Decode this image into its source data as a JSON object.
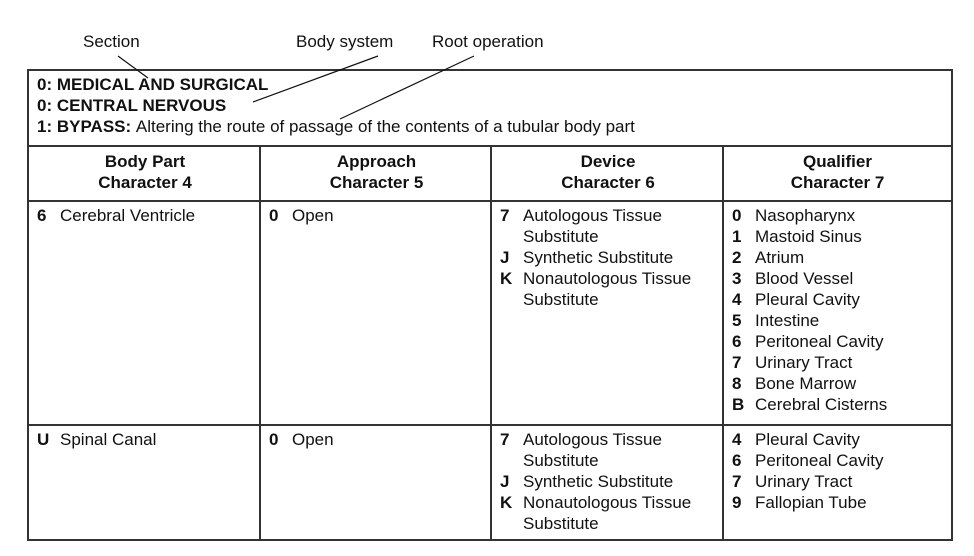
{
  "callouts": {
    "section": "Section",
    "body_system": "Body system",
    "root_operation": "Root operation"
  },
  "title_block": {
    "section": {
      "code": "0:",
      "name": "MEDICAL AND SURGICAL"
    },
    "body_system": {
      "code": "0:",
      "name": "CENTRAL NERVOUS"
    },
    "root_operation": {
      "code": "1:",
      "name": "BYPASS:",
      "definition": "Altering the route of passage of the contents of a tubular body part"
    }
  },
  "columns": [
    {
      "line1": "Body Part",
      "line2": "Character 4"
    },
    {
      "line1": "Approach",
      "line2": "Character 5"
    },
    {
      "line1": "Device",
      "line2": "Character 6"
    },
    {
      "line1": "Qualifier",
      "line2": "Character 7"
    }
  ],
  "rows": [
    {
      "body_part": [
        {
          "code": "6",
          "label": "Cerebral Ventricle"
        }
      ],
      "approach": [
        {
          "code": "0",
          "label": "Open"
        }
      ],
      "device": [
        {
          "code": "7",
          "label": "Autologous Tissue Substitute"
        },
        {
          "code": "J",
          "label": "Synthetic Substitute"
        },
        {
          "code": "K",
          "label": "Nonautologous Tissue Substitute"
        }
      ],
      "qualifier": [
        {
          "code": "0",
          "label": "Nasopharynx"
        },
        {
          "code": "1",
          "label": "Mastoid Sinus"
        },
        {
          "code": "2",
          "label": "Atrium"
        },
        {
          "code": "3",
          "label": "Blood Vessel"
        },
        {
          "code": "4",
          "label": "Pleural Cavity"
        },
        {
          "code": "5",
          "label": "Intestine"
        },
        {
          "code": "6",
          "label": "Peritoneal Cavity"
        },
        {
          "code": "7",
          "label": "Urinary Tract"
        },
        {
          "code": "8",
          "label": "Bone Marrow"
        },
        {
          "code": "B",
          "label": "Cerebral Cisterns"
        }
      ]
    },
    {
      "body_part": [
        {
          "code": "U",
          "label": "Spinal Canal"
        }
      ],
      "approach": [
        {
          "code": "0",
          "label": "Open"
        }
      ],
      "device": [
        {
          "code": "7",
          "label": "Autologous Tissue Substitute"
        },
        {
          "code": "J",
          "label": "Synthetic Substitute"
        },
        {
          "code": "K",
          "label": "Nonautologous Tissue Substitute"
        }
      ],
      "qualifier": [
        {
          "code": "4",
          "label": "Pleural Cavity"
        },
        {
          "code": "6",
          "label": "Peritoneal Cavity"
        },
        {
          "code": "7",
          "label": "Urinary Tract"
        },
        {
          "code": "9",
          "label": "Fallopian Tube"
        }
      ]
    }
  ]
}
